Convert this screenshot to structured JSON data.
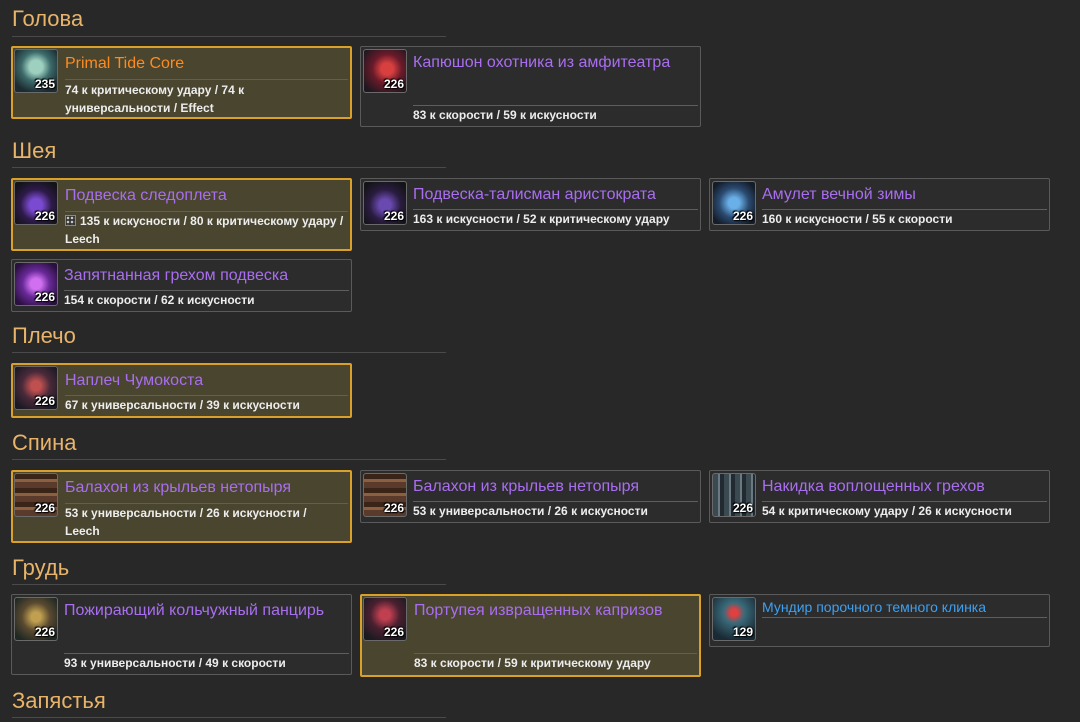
{
  "sections": {
    "head": {
      "title": "Голова"
    },
    "neck": {
      "title": "Шея"
    },
    "shoulder": {
      "title": "Плечо"
    },
    "back": {
      "title": "Спина"
    },
    "chest": {
      "title": "Грудь"
    },
    "wrist": {
      "title": "Запястья"
    }
  },
  "items": {
    "head_1": {
      "name": "Primal Tide Core",
      "ilvl": "235",
      "stats": "74 к критическому удару / 74 к универсальности / Effect"
    },
    "head_2": {
      "name": "Капюшон охотника из амфитеатра",
      "ilvl": "226",
      "stats": "83 к скорости / 59 к искусности"
    },
    "neck_1": {
      "name": "Подвеска следоплета",
      "ilvl": "226",
      "stats": "135 к искусности / 80 к критическому удару / Leech"
    },
    "neck_2": {
      "name": "Подвеска-талисман аристократа",
      "ilvl": "226",
      "stats": "163 к искусности / 52 к критическому удару"
    },
    "neck_3": {
      "name": "Амулет вечной зимы",
      "ilvl": "226",
      "stats": "160 к искусности / 55 к скорости"
    },
    "neck_4": {
      "name": "Запятнанная грехом подвеска",
      "ilvl": "226",
      "stats": "154 к скорости / 62 к искусности"
    },
    "shoulder_1": {
      "name": "Наплеч Чумокоста",
      "ilvl": "226",
      "stats": "67 к универсальности / 39 к искусности"
    },
    "back_1": {
      "name": "Балахон из крыльев нетопыря",
      "ilvl": "226",
      "stats": "53 к универсальности / 26 к искусности / Leech"
    },
    "back_2": {
      "name": "Балахон из крыльев нетопыря",
      "ilvl": "226",
      "stats": "53 к универсальности / 26 к искусности"
    },
    "back_3": {
      "name": "Накидка воплощенных грехов",
      "ilvl": "226",
      "stats": "54 к критическому удару / 26 к искусности"
    },
    "chest_1": {
      "name": "Пожирающий кольчужный панцирь",
      "ilvl": "226",
      "stats": "93 к универсальности / 49 к скорости"
    },
    "chest_2": {
      "name": "Портупея извращенных капризов",
      "ilvl": "226",
      "stats": "83 к скорости / 59 к критическому удару"
    },
    "chest_3": {
      "name": "Мундир порочного темного клинка",
      "ilvl": "129",
      "stats": ""
    }
  },
  "colors": {
    "section_title": "#e8b469",
    "epic_item": "#a96ef0",
    "legendary_item": "#ff8b1f",
    "rare_item": "#3ea0f0",
    "highlight_border": "#d9a12a"
  }
}
